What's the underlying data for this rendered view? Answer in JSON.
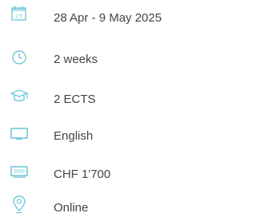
{
  "info": {
    "accent_color": "#73c8dc",
    "items": [
      {
        "icon": "calendar-icon",
        "label": "28 Apr - 9 May 2025"
      },
      {
        "icon": "clock-icon",
        "label": "2 weeks"
      },
      {
        "icon": "graduation-cap-icon",
        "label": "2 ECTS"
      },
      {
        "icon": "language-icon",
        "label": "English"
      },
      {
        "icon": "fee-icon",
        "label": "CHF 1'700"
      },
      {
        "icon": "location-pin-icon",
        "label": "Online"
      }
    ]
  }
}
